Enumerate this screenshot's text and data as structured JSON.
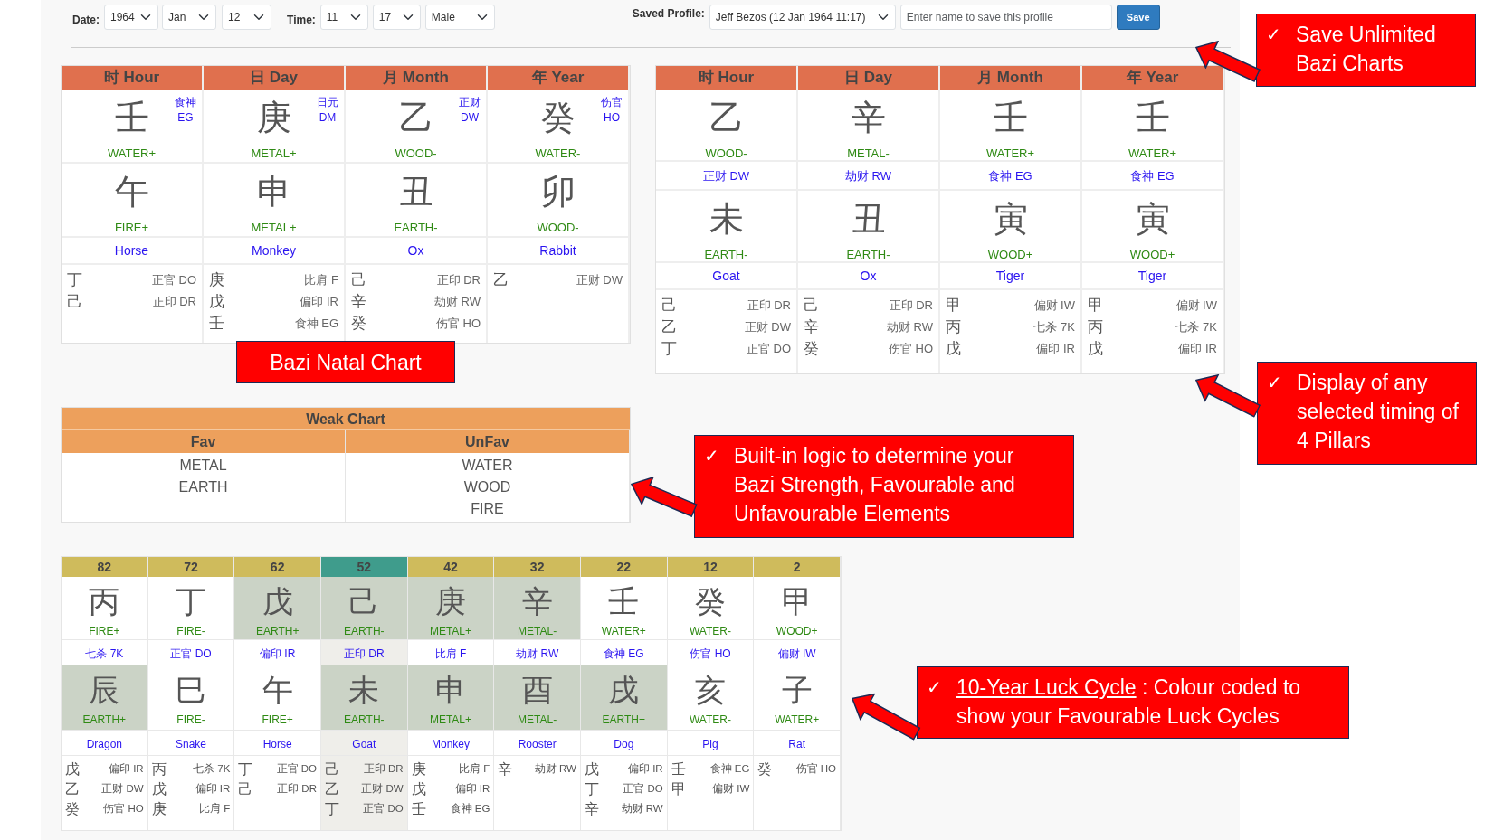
{
  "form": {
    "date_label": "Date:",
    "year": "1964",
    "month": "Jan",
    "day": "12",
    "time_label": "Time:",
    "hour": "11",
    "minute": "17",
    "gender": "Male",
    "saved_profile_label": "Saved Profile:",
    "saved_profile": "Jeff Bezos (12 Jan 1964 11:17)",
    "name_placeholder": "Enter name to save this profile",
    "save_button": "Save"
  },
  "natal_chart": {
    "pillars": [
      {
        "heading": "时 Hour",
        "stem": "壬",
        "stem_god": "食神",
        "stem_god_code": "EG",
        "stem_element": "WATER+",
        "branch": "午",
        "branch_element": "FIRE+",
        "animal": "Horse",
        "hidden": [
          {
            "stem": "丁",
            "god": "正官 DO"
          },
          {
            "stem": "己",
            "god": "正印 DR"
          }
        ]
      },
      {
        "heading": "日 Day",
        "stem": "庚",
        "stem_god": "日元",
        "stem_god_code": "DM",
        "stem_element": "METAL+",
        "branch": "申",
        "branch_element": "METAL+",
        "animal": "Monkey",
        "hidden": [
          {
            "stem": "庚",
            "god": "比肩 F"
          },
          {
            "stem": "戊",
            "god": "偏印 IR"
          },
          {
            "stem": "壬",
            "god": "食神 EG"
          }
        ]
      },
      {
        "heading": "月 Month",
        "stem": "乙",
        "stem_god": "正财",
        "stem_god_code": "DW",
        "stem_element": "WOOD-",
        "branch": "丑",
        "branch_element": "EARTH-",
        "animal": "Ox",
        "hidden": [
          {
            "stem": "己",
            "god": "正印 DR"
          },
          {
            "stem": "辛",
            "god": "劫财 RW"
          },
          {
            "stem": "癸",
            "god": "伤官 HO"
          }
        ]
      },
      {
        "heading": "年 Year",
        "stem": "癸",
        "stem_god": "伤官",
        "stem_god_code": "HO",
        "stem_element": "WATER-",
        "branch": "卯",
        "branch_element": "WOOD-",
        "animal": "Rabbit",
        "hidden": [
          {
            "stem": "乙",
            "god": "正财 DW"
          }
        ]
      }
    ]
  },
  "natal_label": "Bazi Natal Chart",
  "timing_chart": {
    "pillars": [
      {
        "heading": "时 Hour",
        "stem": "乙",
        "stem_element": "WOOD-",
        "ten_god": "正财 DW",
        "branch": "未",
        "branch_element": "EARTH-",
        "animal": "Goat",
        "hidden": [
          {
            "stem": "己",
            "god": "正印 DR"
          },
          {
            "stem": "乙",
            "god": "正财 DW"
          },
          {
            "stem": "丁",
            "god": "正官 DO"
          }
        ]
      },
      {
        "heading": "日 Day",
        "stem": "辛",
        "stem_element": "METAL-",
        "ten_god": "劫财 RW",
        "branch": "丑",
        "branch_element": "EARTH-",
        "animal": "Ox",
        "hidden": [
          {
            "stem": "己",
            "god": "正印 DR"
          },
          {
            "stem": "辛",
            "god": "劫财 RW"
          },
          {
            "stem": "癸",
            "god": "伤官 HO"
          }
        ]
      },
      {
        "heading": "月 Month",
        "stem": "壬",
        "stem_element": "WATER+",
        "ten_god": "食神 EG",
        "branch": "寅",
        "branch_element": "WOOD+",
        "animal": "Tiger",
        "hidden": [
          {
            "stem": "甲",
            "god": "偏财 IW"
          },
          {
            "stem": "丙",
            "god": "七杀 7K"
          },
          {
            "stem": "戊",
            "god": "偏印 IR"
          }
        ]
      },
      {
        "heading": "年 Year",
        "stem": "壬",
        "stem_element": "WATER+",
        "ten_god": "食神 EG",
        "branch": "寅",
        "branch_element": "WOOD+",
        "animal": "Tiger",
        "hidden": [
          {
            "stem": "甲",
            "god": "偏财 IW"
          },
          {
            "stem": "丙",
            "god": "七杀 7K"
          },
          {
            "stem": "戊",
            "god": "偏印 IR"
          }
        ]
      }
    ]
  },
  "strength_table": {
    "title": "Weak Chart",
    "columns": [
      "Fav",
      "UnFav"
    ],
    "fav": [
      "METAL",
      "EARTH"
    ],
    "unfav": [
      "WATER",
      "WOOD",
      "FIRE"
    ]
  },
  "luck_cycle": {
    "pillars": [
      {
        "age": "82",
        "selected": false,
        "stem": "丙",
        "stem_element": "FIRE+",
        "stem_favourable": false,
        "ten_god": "七杀 7K",
        "branch": "辰",
        "branch_element": "EARTH+",
        "branch_favourable": true,
        "animal": "Dragon",
        "hidden": [
          {
            "stem": "戊",
            "god": "偏印 IR"
          },
          {
            "stem": "乙",
            "god": "正财 DW"
          },
          {
            "stem": "癸",
            "god": "伤官 HO"
          }
        ]
      },
      {
        "age": "72",
        "selected": false,
        "stem": "丁",
        "stem_element": "FIRE-",
        "stem_favourable": false,
        "ten_god": "正官 DO",
        "branch": "巳",
        "branch_element": "FIRE-",
        "branch_favourable": false,
        "animal": "Snake",
        "hidden": [
          {
            "stem": "丙",
            "god": "七杀 7K"
          },
          {
            "stem": "戊",
            "god": "偏印 IR"
          },
          {
            "stem": "庚",
            "god": "比肩 F"
          }
        ]
      },
      {
        "age": "62",
        "selected": false,
        "stem": "戊",
        "stem_element": "EARTH+",
        "stem_favourable": true,
        "ten_god": "偏印 IR",
        "branch": "午",
        "branch_element": "FIRE+",
        "branch_favourable": false,
        "animal": "Horse",
        "hidden": [
          {
            "stem": "丁",
            "god": "正官 DO"
          },
          {
            "stem": "己",
            "god": "正印 DR"
          }
        ]
      },
      {
        "age": "52",
        "selected": true,
        "stem": "己",
        "stem_element": "EARTH-",
        "stem_favourable": true,
        "ten_god": "正印 DR",
        "branch": "未",
        "branch_element": "EARTH-",
        "branch_favourable": true,
        "animal": "Goat",
        "hidden": [
          {
            "stem": "己",
            "god": "正印 DR"
          },
          {
            "stem": "乙",
            "god": "正财 DW"
          },
          {
            "stem": "丁",
            "god": "正官 DO"
          }
        ]
      },
      {
        "age": "42",
        "selected": false,
        "stem": "庚",
        "stem_element": "METAL+",
        "stem_favourable": true,
        "ten_god": "比肩 F",
        "branch": "申",
        "branch_element": "METAL+",
        "branch_favourable": true,
        "animal": "Monkey",
        "hidden": [
          {
            "stem": "庚",
            "god": "比肩 F"
          },
          {
            "stem": "戊",
            "god": "偏印 IR"
          },
          {
            "stem": "壬",
            "god": "食神 EG"
          }
        ]
      },
      {
        "age": "32",
        "selected": false,
        "stem": "辛",
        "stem_element": "METAL-",
        "stem_favourable": true,
        "ten_god": "劫财 RW",
        "branch": "酉",
        "branch_element": "METAL-",
        "branch_favourable": true,
        "animal": "Rooster",
        "hidden": [
          {
            "stem": "辛",
            "god": "劫财 RW"
          }
        ]
      },
      {
        "age": "22",
        "selected": false,
        "stem": "壬",
        "stem_element": "WATER+",
        "stem_favourable": false,
        "ten_god": "食神 EG",
        "branch": "戌",
        "branch_element": "EARTH+",
        "branch_favourable": true,
        "animal": "Dog",
        "hidden": [
          {
            "stem": "戊",
            "god": "偏印 IR"
          },
          {
            "stem": "丁",
            "god": "正官 DO"
          },
          {
            "stem": "辛",
            "god": "劫财 RW"
          }
        ]
      },
      {
        "age": "12",
        "selected": false,
        "stem": "癸",
        "stem_element": "WATER-",
        "stem_favourable": false,
        "ten_god": "伤官 HO",
        "branch": "亥",
        "branch_element": "WATER-",
        "branch_favourable": false,
        "animal": "Pig",
        "hidden": [
          {
            "stem": "壬",
            "god": "食神 EG"
          },
          {
            "stem": "甲",
            "god": "偏财 IW"
          }
        ]
      },
      {
        "age": "2",
        "selected": false,
        "stem": "甲",
        "stem_element": "WOOD+",
        "stem_favourable": false,
        "ten_god": "偏财 IW",
        "branch": "子",
        "branch_element": "WATER+",
        "branch_favourable": false,
        "animal": "Rat",
        "hidden": [
          {
            "stem": "癸",
            "god": "伤官 HO"
          }
        ]
      }
    ]
  },
  "callouts": [
    {
      "kind": "save",
      "mark": "✓",
      "text": "Save Unlimited Bazi Charts"
    },
    {
      "kind": "timing",
      "mark": "✓",
      "text": "Display of any selected timing of 4 Pillars"
    },
    {
      "kind": "strength",
      "mark": "✓",
      "text": "Built-in logic to determine your Bazi Strength, Favourable and Unfavourable Elements"
    },
    {
      "kind": "luck",
      "mark": "✓",
      "link": "10-Year Luck Cycle",
      "text": " : Colour coded to show your Favourable Luck Cycles"
    }
  ]
}
